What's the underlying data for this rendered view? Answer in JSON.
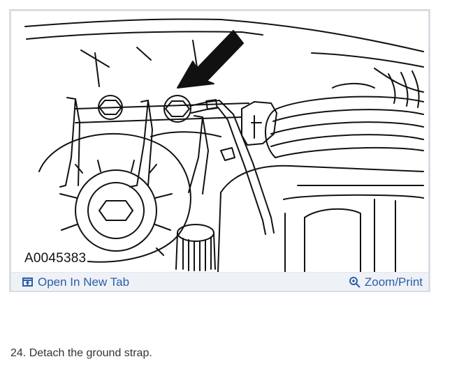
{
  "figure": {
    "id_label": "A0045383",
    "open_tab_label": "Open In New Tab",
    "zoom_print_label": "Zoom/Print",
    "icons": {
      "open_tab": "open-new-tab-icon",
      "zoom": "zoom-magnifier-icon"
    }
  },
  "step": {
    "text": "24. Detach the ground strap."
  },
  "colors": {
    "link": "#2b5ea8",
    "toolbar_bg": "#eef1f6",
    "frame_border": "#d9dde2",
    "body_text": "#333333"
  }
}
